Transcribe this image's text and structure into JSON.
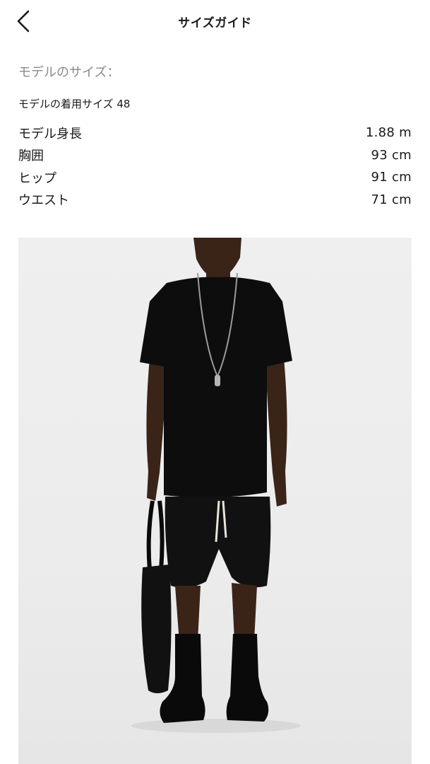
{
  "header": {
    "back_icon": "chevron-left-icon",
    "title": "サイズガイド"
  },
  "model_section": {
    "heading": "モデルのサイズ：",
    "wearing_size": "モデルの着用サイズ 48",
    "measurements": [
      {
        "label": "モデル身長",
        "value": "1.88 m"
      },
      {
        "label": "胸囲",
        "value": "93 cm"
      },
      {
        "label": "ヒップ",
        "value": "91 cm"
      },
      {
        "label": "ウエスト",
        "value": "71 cm"
      }
    ]
  },
  "photo": {
    "description_icon": "model-photo"
  }
}
